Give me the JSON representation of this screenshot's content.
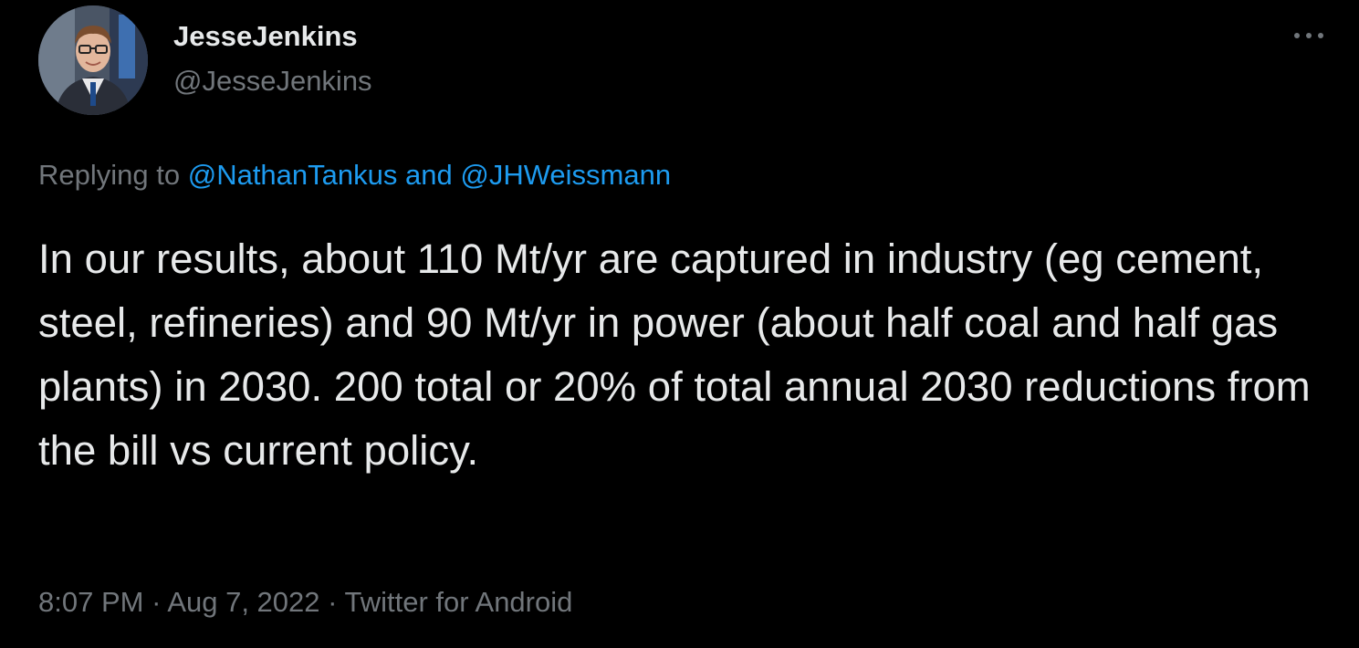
{
  "author": {
    "display_name": "JesseJenkins",
    "handle": "@JesseJenkins",
    "avatar_icon": "profile-photo"
  },
  "more_icon": "more-horizontal-icon",
  "reply": {
    "prefix": "Replying to",
    "mention1": "@NathanTankus",
    "joiner": "and",
    "mention2": "@JHWeissmann"
  },
  "tweet": {
    "text": "In our results, about 110 Mt/yr are captured in industry (eg cement, steel, refineries) and 90 Mt/yr in power (about half coal and half gas plants) in 2030. 200 total or 20% of total annual 2030 reductions from the bill vs current policy."
  },
  "meta": {
    "time": "8:07 PM",
    "separator": "·",
    "date": "Aug 7, 2022",
    "source": "Twitter for Android"
  },
  "colors": {
    "background": "#000000",
    "primary_text": "#e7e9ea",
    "secondary_text": "#71767b",
    "link": "#1d9bf0"
  }
}
